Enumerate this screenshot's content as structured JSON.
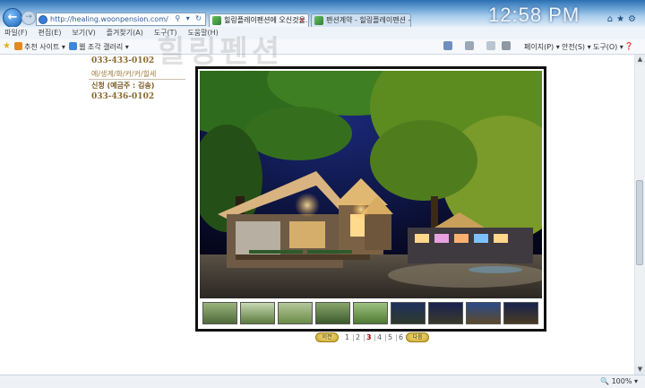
{
  "browser": {
    "address": "http://healing.woonpension.com/",
    "tabs": [
      {
        "label": "힐링플레이펜션에 오신것을..."
      },
      {
        "label": "펜션계약 - 힐링플레이펜션 - 우..."
      }
    ],
    "clock": "12:58 PM",
    "menu": [
      "파일(F)",
      "편집(E)",
      "보기(V)",
      "즐겨찾기(A)",
      "도구(T)",
      "도움말(H)"
    ],
    "favorites": [
      {
        "label": "추천 사이트 ▾"
      },
      {
        "label": "웹 조각 갤러리 ▾"
      }
    ],
    "commands": [
      "페이지(P) ▾",
      "안전(S) ▾",
      "도구(O) ▾"
    ],
    "zoom": "100%"
  },
  "watermark": "힐링펜션",
  "contact": {
    "phone1": "033-433-0102",
    "subinfo": "예/생계/화/커/커/힐세",
    "name": "신청 (예금주 : 김송)",
    "phone2": "033-436-0102"
  },
  "gallery": {
    "thumb_count": 9,
    "pager": {
      "prev_label": "이전",
      "next_label": "다음",
      "pages": [
        "1",
        "2",
        "3",
        "4",
        "5",
        "6"
      ],
      "current": "3"
    }
  },
  "colors": {
    "accent_gold": "#c9a227",
    "text_brown": "#8b6a2f",
    "pager_current": "#b3000d"
  }
}
